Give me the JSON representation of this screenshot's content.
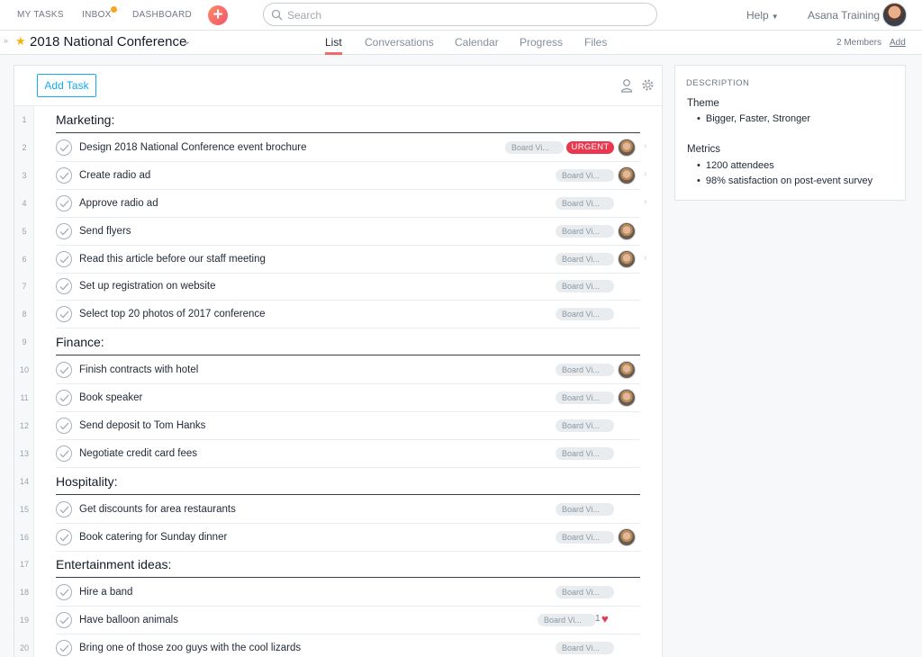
{
  "topbar": {
    "nav": [
      "MY TASKS",
      "INBOX",
      "DASHBOARD"
    ],
    "add_symbol": "+",
    "search_placeholder": "Search",
    "help_label": "Help",
    "user_name": "Asana Training"
  },
  "project": {
    "title": "2018 National Conference",
    "tabs": [
      "List",
      "Conversations",
      "Calendar",
      "Progress",
      "Files"
    ],
    "active_tab": "List",
    "members": "2 Members",
    "add_label": "Add"
  },
  "list": {
    "add_task_label": "Add Task",
    "tag_label": "Board Vi...",
    "urgent_label": "URGENT",
    "rows": [
      {
        "num": "1",
        "type": "section",
        "title": "Marketing:"
      },
      {
        "num": "2",
        "type": "task",
        "title": "Design 2018 National Conference event brochure"
      },
      {
        "num": "3",
        "type": "task",
        "title": "Create radio ad"
      },
      {
        "num": "4",
        "type": "task",
        "title": "Approve radio ad"
      },
      {
        "num": "5",
        "type": "task",
        "title": "Send flyers"
      },
      {
        "num": "6",
        "type": "task",
        "title": "Read this article before our staff meeting"
      },
      {
        "num": "7",
        "type": "task",
        "title": "Set up registration on website"
      },
      {
        "num": "8",
        "type": "task",
        "title": "Select top 20 photos of 2017 conference"
      },
      {
        "num": "9",
        "type": "section",
        "title": "Finance:"
      },
      {
        "num": "10",
        "type": "task",
        "title": "Finish contracts with hotel"
      },
      {
        "num": "11",
        "type": "task",
        "title": "Book speaker"
      },
      {
        "num": "12",
        "type": "task",
        "title": "Send deposit to Tom Hanks"
      },
      {
        "num": "13",
        "type": "task",
        "title": "Negotiate credit card fees"
      },
      {
        "num": "14",
        "type": "section",
        "title": "Hospitality:"
      },
      {
        "num": "15",
        "type": "task",
        "title": "Get discounts for area restaurants"
      },
      {
        "num": "16",
        "type": "task",
        "title": "Book catering for Sunday dinner"
      },
      {
        "num": "17",
        "type": "section",
        "title": "Entertainment ideas:"
      },
      {
        "num": "18",
        "type": "task",
        "title": "Hire a band"
      },
      {
        "num": "19",
        "type": "task",
        "title": "Have balloon animals",
        "likes": "1"
      },
      {
        "num": "20",
        "type": "task",
        "title": "Bring one of those zoo guys with the cool lizards"
      }
    ]
  },
  "description": {
    "heading": "DESCRIPTION",
    "theme_label": "Theme",
    "theme_items": [
      "Bigger, Faster, Stronger"
    ],
    "metrics_label": "Metrics",
    "metrics_items": [
      "1200 attendees",
      "98% satisfaction on post-event survey"
    ]
  },
  "colors": {
    "accent": "#14aaf5",
    "urgent": "#e8384f",
    "tab_underline": "#f06a6a",
    "star": "#f5b30c"
  }
}
